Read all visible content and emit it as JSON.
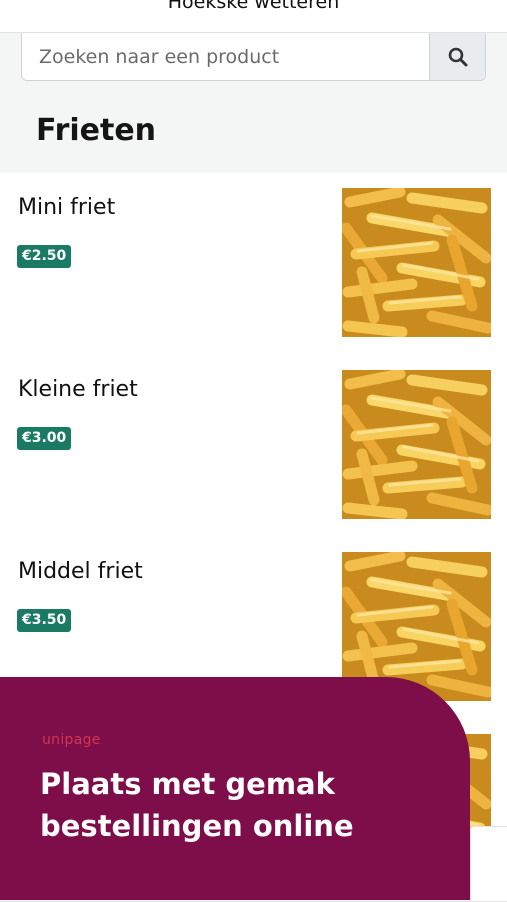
{
  "header": {
    "title": "Hoekske wetteren"
  },
  "search": {
    "placeholder": "Zoeken naar een product"
  },
  "category": {
    "title": "Frieten"
  },
  "products": [
    {
      "name": "Mini friet",
      "price": "€2.50"
    },
    {
      "name": "Kleine friet",
      "price": "€3.00"
    },
    {
      "name": "Middel friet",
      "price": "€3.50"
    }
  ],
  "promo": {
    "logo": "unipage",
    "headline": "Plaats met gemak bestellingen online"
  },
  "colors": {
    "price_badge": "#1b7a63",
    "promo_background": "#7d0e4a",
    "promo_logo": "#d2364e"
  }
}
